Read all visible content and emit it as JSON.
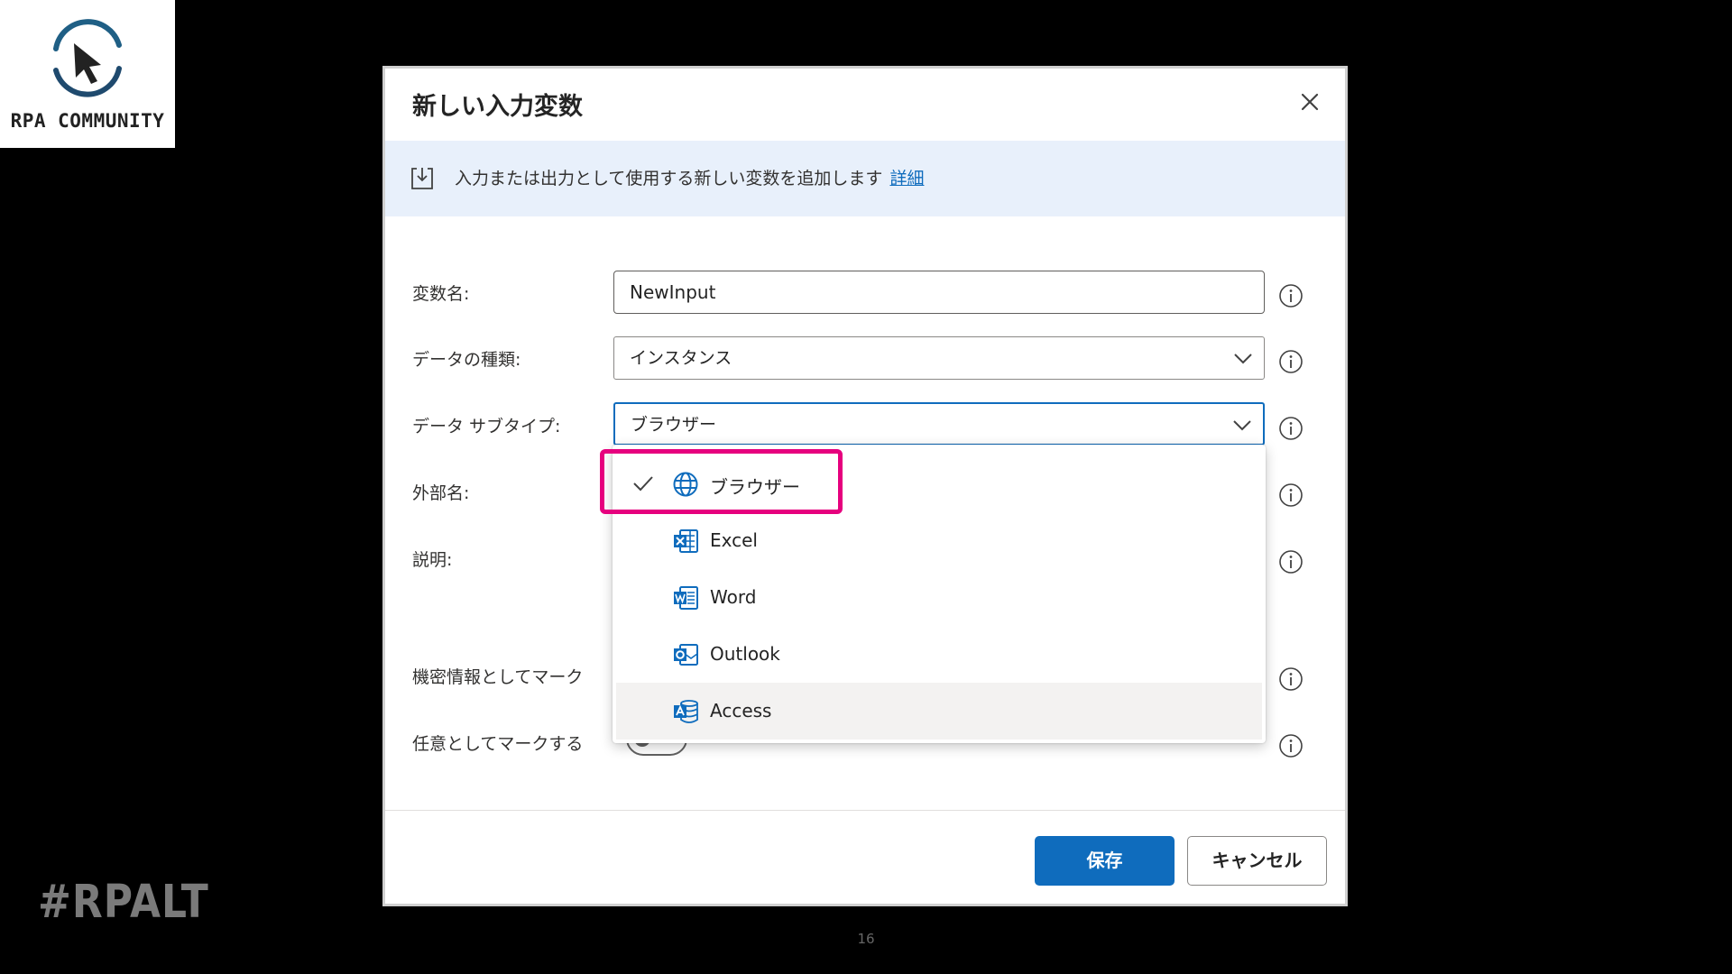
{
  "branding": {
    "logo_text": "RPA COMMUNITY",
    "hashtag": "#RPALT",
    "slide_number": "16"
  },
  "dialog": {
    "title": "新しい入力変数",
    "info_text": "入力または出力として使用する新しい変数を追加します",
    "info_link": "詳細",
    "fields": {
      "variable_name_label": "変数名:",
      "variable_name_value": "NewInput",
      "data_type_label": "データの種類:",
      "data_type_value": "インスタンス",
      "data_subtype_label": "データ サブタイプ:",
      "data_subtype_value": "ブラウザー",
      "external_name_label": "外部名:",
      "description_label": "説明:",
      "sensitive_label": "機密情報としてマーク",
      "optional_label": "任意としてマークする"
    },
    "dropdown_options": [
      {
        "label": "ブラウザー",
        "icon": "globe-icon",
        "selected": true
      },
      {
        "label": "Excel",
        "icon": "excel-icon",
        "selected": false
      },
      {
        "label": "Word",
        "icon": "word-icon",
        "selected": false
      },
      {
        "label": "Outlook",
        "icon": "outlook-icon",
        "selected": false
      },
      {
        "label": "Access",
        "icon": "access-icon",
        "selected": false,
        "hovered": true
      }
    ],
    "buttons": {
      "save": "保存",
      "cancel": "キャンセル"
    }
  },
  "colors": {
    "accent": "#0f6cbd",
    "highlight": "#e6007e",
    "info_bar": "#e8f0fb"
  }
}
